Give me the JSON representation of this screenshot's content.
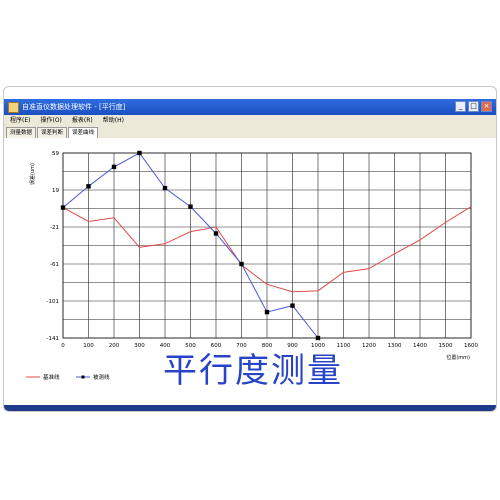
{
  "window": {
    "title": "自准直仪数据处理软件 - [平行度]",
    "buttons": [
      "_",
      "□",
      "×"
    ]
  },
  "menu": [
    "程序(E)",
    "操作(O)",
    "报表(R)",
    "帮助(H)"
  ],
  "tabs": [
    {
      "label": "测量数据",
      "active": false
    },
    {
      "label": "误差判断",
      "active": false
    },
    {
      "label": "误差曲线",
      "active": true
    }
  ],
  "chart_data": {
    "type": "line",
    "ylabel": "误差(um)",
    "xlabel": "位置(mm)",
    "x_ticks": [
      0,
      100,
      200,
      300,
      400,
      500,
      600,
      700,
      800,
      900,
      1000,
      1100,
      1200,
      1300,
      1400,
      1500,
      1600
    ],
    "y_ticks": [
      59,
      19,
      -21,
      -61,
      -101,
      -141
    ],
    "ylim": [
      -141,
      59
    ],
    "xlim": [
      0,
      1600
    ],
    "grid": true,
    "legend": "bottom-left",
    "series": [
      {
        "name": "基准线",
        "color": "#e04a4a",
        "marker": "none",
        "x": [
          0,
          100,
          200,
          300,
          400,
          500,
          600,
          700,
          800,
          900,
          1000,
          1100,
          1200,
          1300,
          1400,
          1500,
          1600
        ],
        "y": [
          0,
          -15,
          -11,
          -43,
          -39,
          -26,
          -21,
          -62,
          -83,
          -91,
          -90,
          -70,
          -66,
          -50,
          -35,
          -16,
          1
        ]
      },
      {
        "name": "被测线",
        "color": "#4b55d6",
        "marker": "square",
        "x": [
          0,
          100,
          200,
          300,
          400,
          500,
          600,
          700,
          800,
          900,
          1000
        ],
        "y": [
          0,
          23,
          44,
          59,
          21,
          1,
          -28,
          -61,
          -113,
          -106,
          -141
        ]
      }
    ]
  },
  "caption": "平行度测量"
}
